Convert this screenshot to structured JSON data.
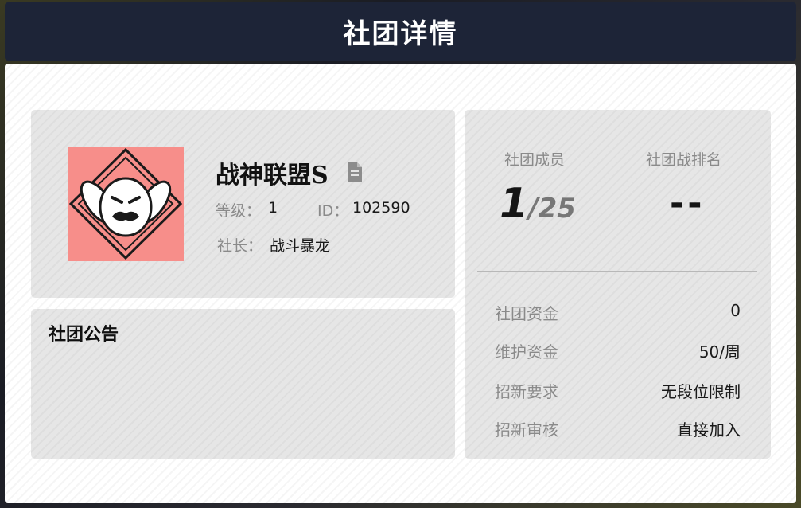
{
  "header": {
    "title": "社团详情"
  },
  "club": {
    "name": "战神联盟S",
    "level_label": "等级：",
    "level_value": "1",
    "id_label": "ID：",
    "id_value": "102590",
    "leader_label": "社长：",
    "leader_value": "战斗暴龙"
  },
  "notice": {
    "title": "社团公告"
  },
  "stats": {
    "members_label": "社团成员",
    "members_current": "1",
    "members_max": "/25",
    "rank_label": "社团战排名",
    "rank_value": "--"
  },
  "details": [
    {
      "label": "社团资金",
      "value": "0"
    },
    {
      "label": "维护资金",
      "value": "50/周"
    },
    {
      "label": "招新要求",
      "value": "无段位限制"
    },
    {
      "label": "招新审核",
      "value": "直接加入"
    }
  ],
  "colors": {
    "header_bg": "#1d2437",
    "avatar_bg": "#f78e8a"
  },
  "icons": {
    "avatar": "white-rabbit-emblem-icon",
    "copy": "copy-icon"
  }
}
